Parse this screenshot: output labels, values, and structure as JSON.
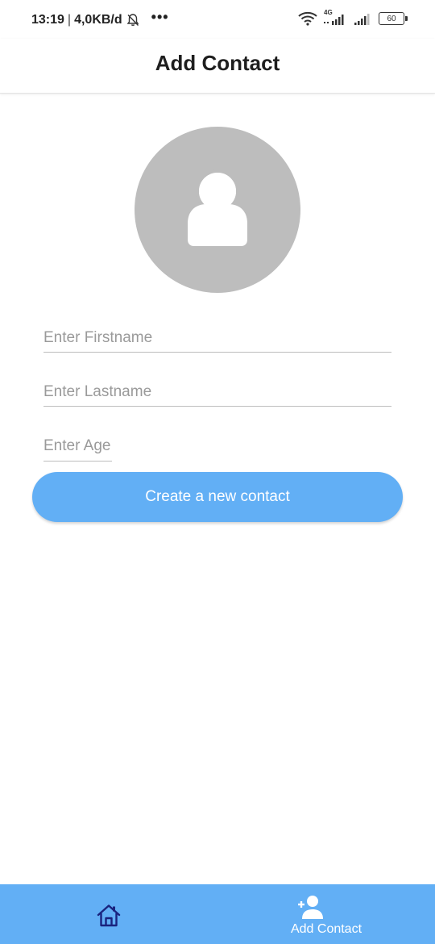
{
  "status_bar": {
    "time": "13:19",
    "separator": "|",
    "speed": "4,0KB/d",
    "dots": "•••",
    "network_label": "4G",
    "battery_level": "60"
  },
  "app_bar": {
    "title": "Add Contact"
  },
  "form": {
    "firstname_placeholder": "Enter Firstname",
    "lastname_placeholder": "Enter Lastname",
    "age_placeholder": "Enter Age",
    "create_button_label": "Create a new contact"
  },
  "bottom_nav": {
    "home_icon": "home-icon",
    "add_contact_icon": "person-add-icon",
    "add_contact_label": "Add Contact"
  },
  "colors": {
    "accent": "#62aff5",
    "avatar_bg": "#bdbdbd",
    "home_icon_color": "#1a237e"
  }
}
